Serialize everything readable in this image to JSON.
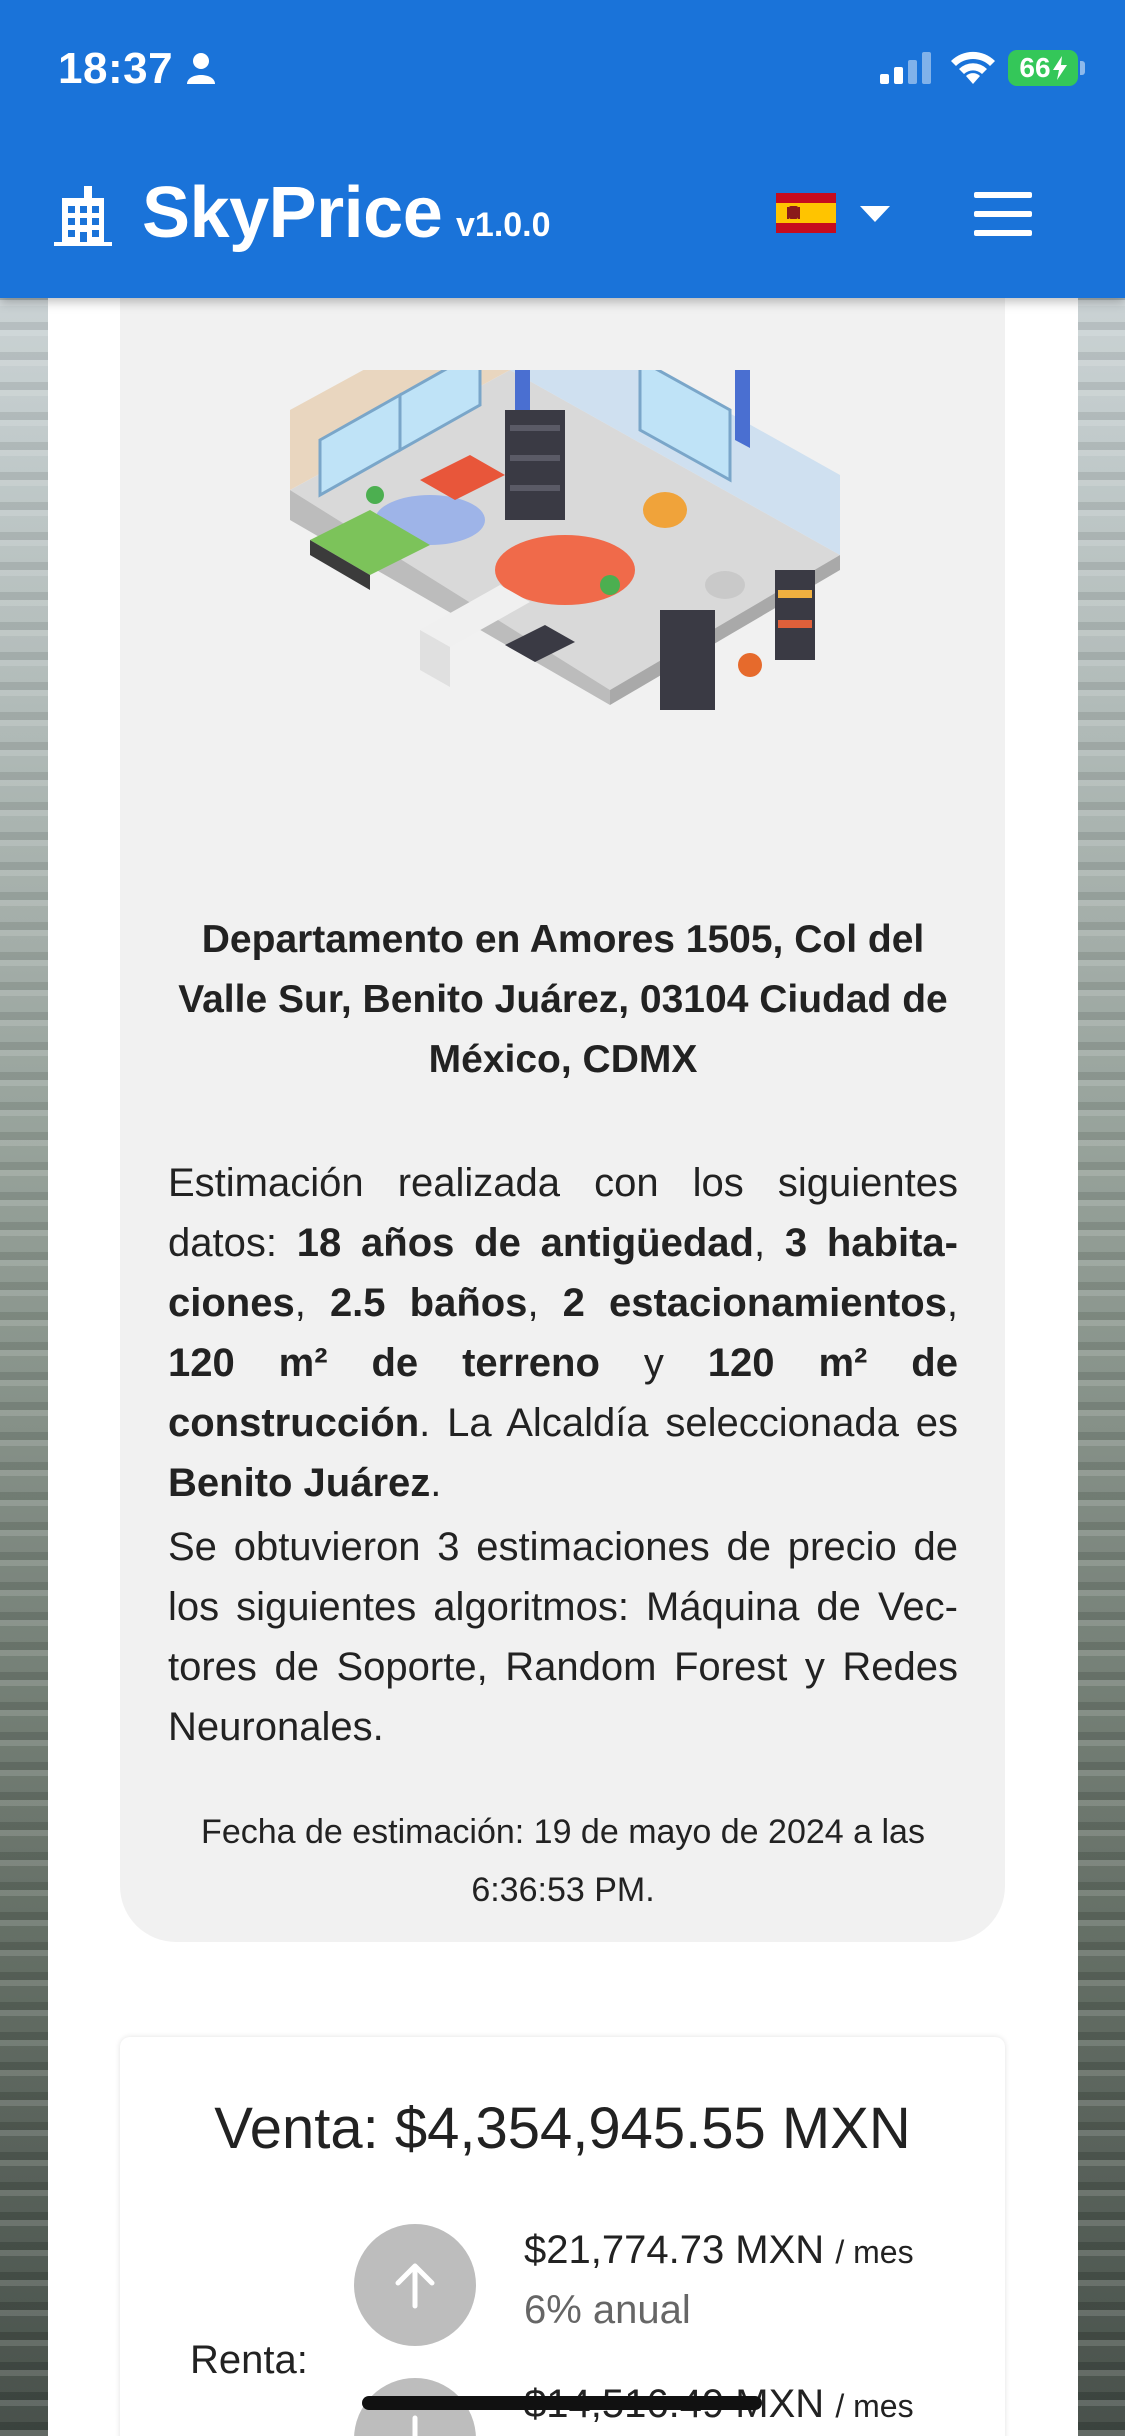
{
  "status_bar": {
    "time": "18:37",
    "battery": "66"
  },
  "header": {
    "app_name": "SkyPrice",
    "version": "v1.0.0",
    "language_flag": "spain-flag-icon",
    "brand_color": "#1a73d9"
  },
  "estimate": {
    "address": "Departamento en Amores 1505, Col del Valle Sur, Benito Juárez, 03104 Ciudad de México, CDMX",
    "intro": "Estimación realizada con los siguientes datos:",
    "age": "18 años de antigüedad",
    "rooms": "3 habita­ciones",
    "baths": "2.5 baños",
    "parking": "2 estacionamientos",
    "land": "120 m² de terreno",
    "and": "y",
    "construction": "120 m² de construcción",
    "alcaldia_intro": ". La Alcaldía seleccionada es",
    "alcaldia": "Benito Juárez",
    "algorithms_text": "Se obtuvieron 3 estimaciones de precio de los siguientes algoritmos: Máquina de Vec­tores de Soporte, Random Forest y Redes Neuronales.",
    "date": "Fecha de estimación: 19 de mayo de 2024 a las 6:36:53 PM."
  },
  "prices": {
    "sale_label": "Venta:",
    "sale_value": "$4,354,945.55 MXN",
    "rent_label": "Renta:",
    "rent_high": "$21,774.73 MXN",
    "rent_high_unit": "/ mes",
    "rent_high_rate": "6% anual",
    "rent_low": "$14,516.49 MXN",
    "rent_low_unit": "/ mes"
  }
}
